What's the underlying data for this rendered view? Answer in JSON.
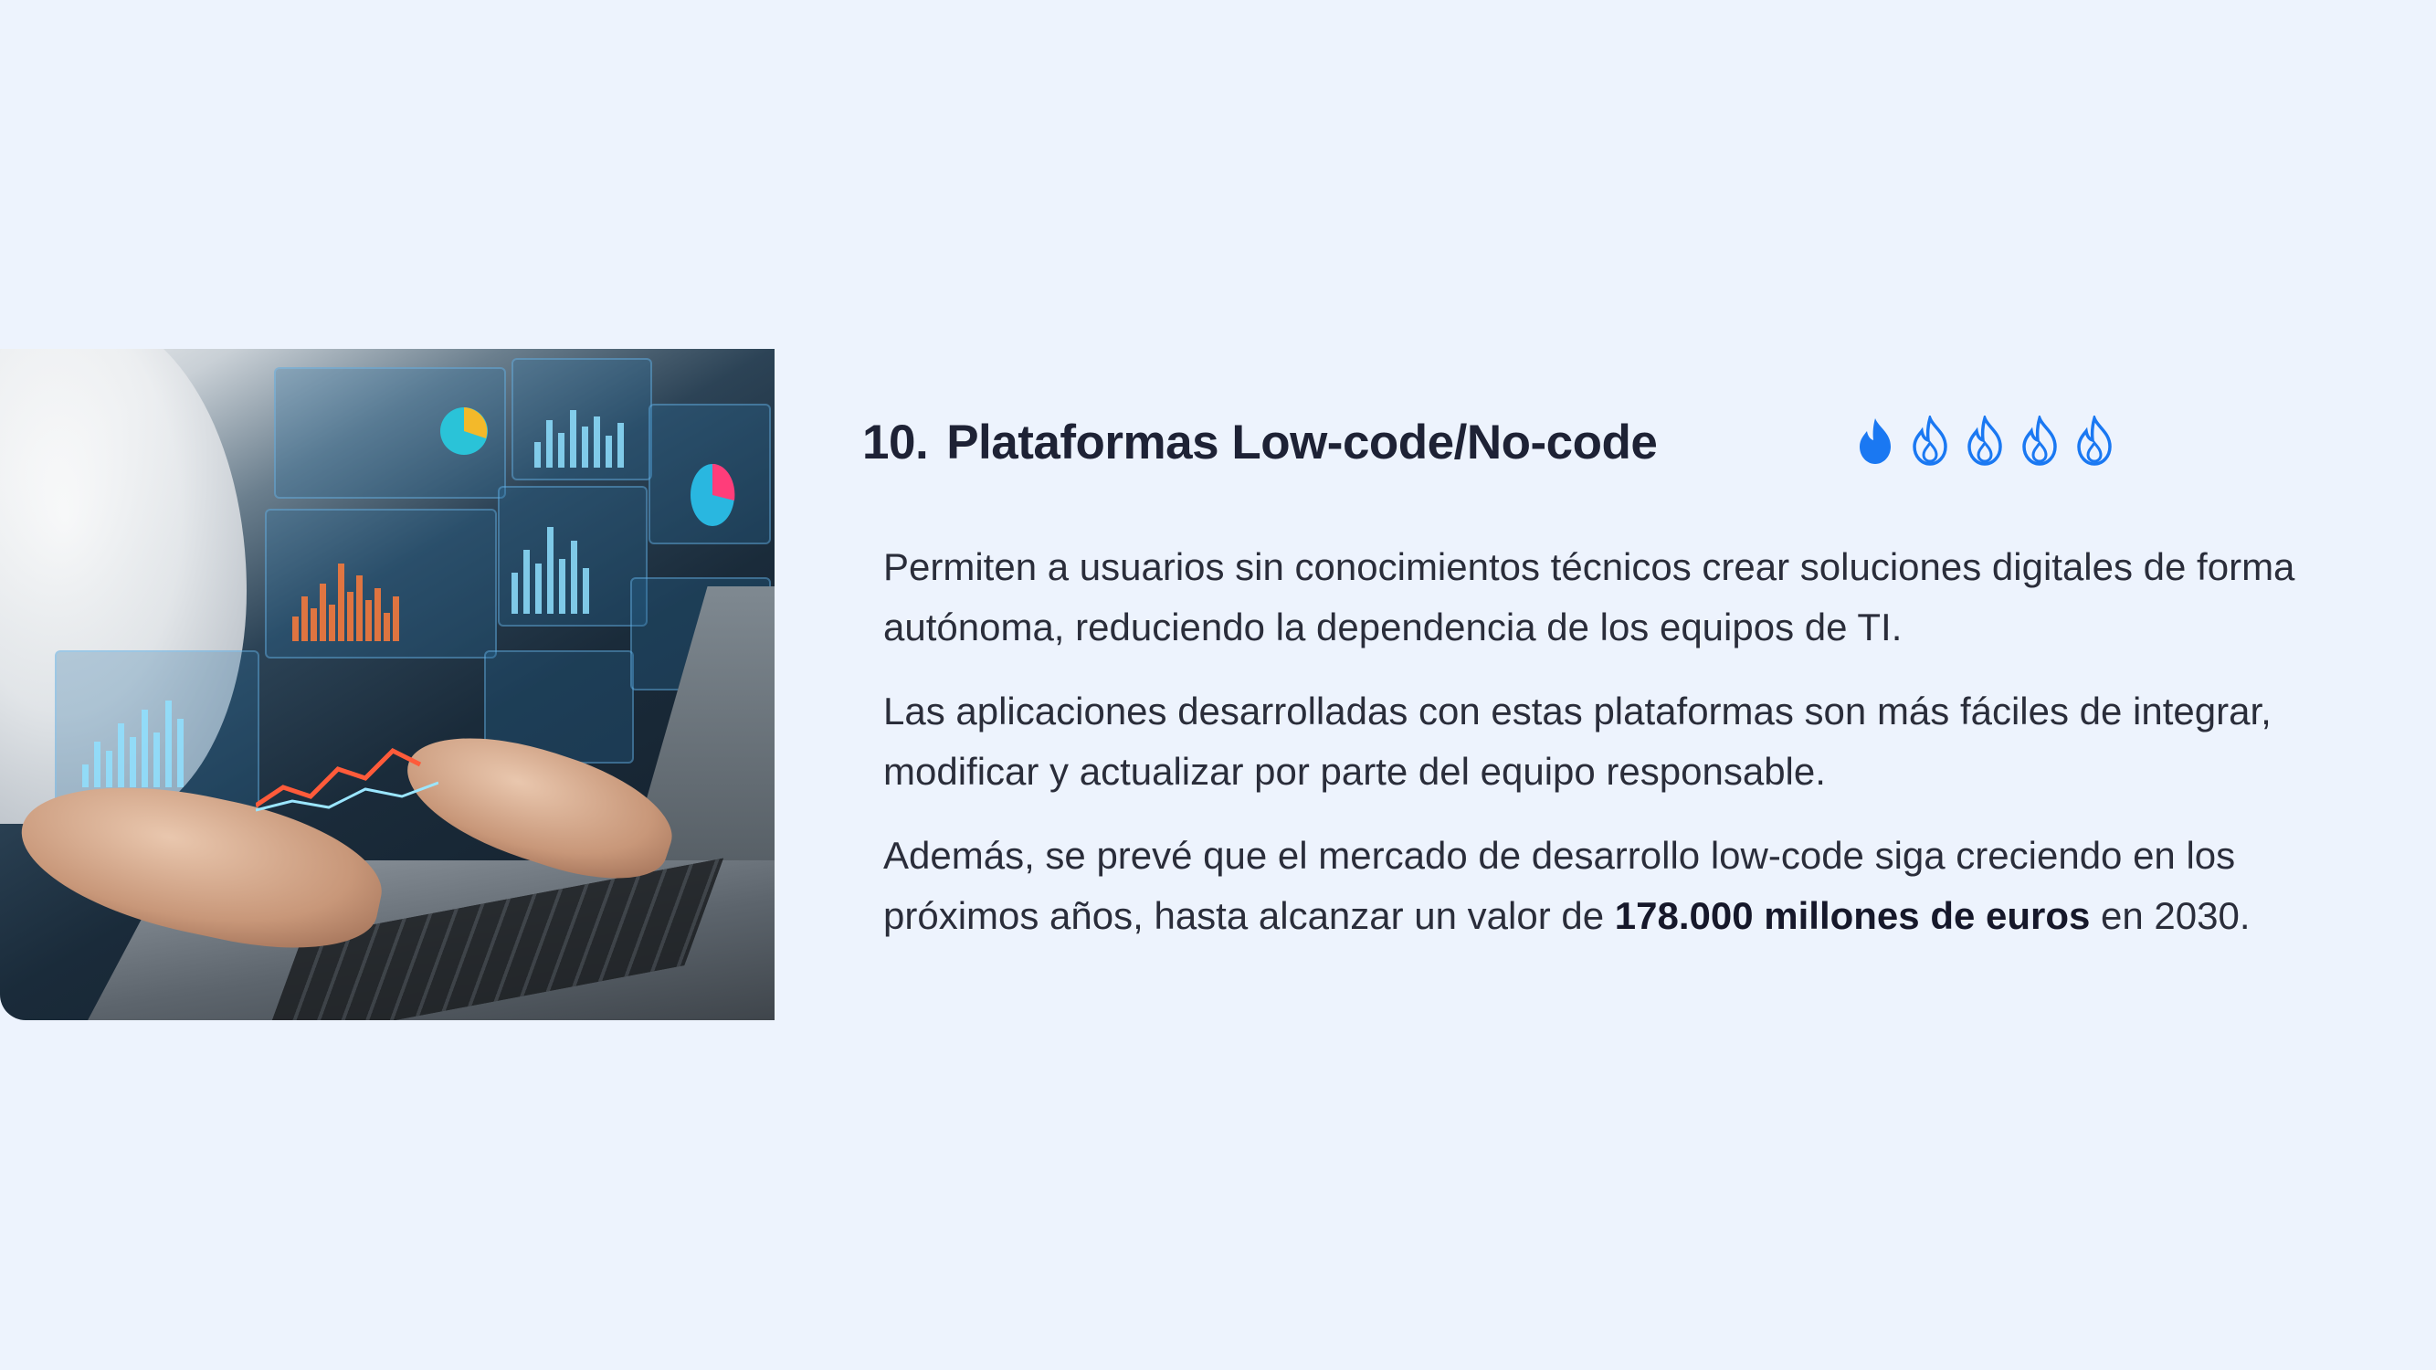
{
  "section": {
    "number": "10.",
    "title": "Plataformas Low-code/No-code",
    "rating": {
      "value": 1,
      "max": 5,
      "icon": "flame-icon",
      "color": "#1a78f2"
    }
  },
  "paragraphs": [
    {
      "text": "Permiten a usuarios sin conocimientos técnicos crear soluciones digitales de forma autónoma, reduciendo la dependencia de los equipos de TI."
    },
    {
      "text": "Las aplicaciones desarrolladas con estas plataformas son más fáciles de integrar, modificar y actualizar por parte del equipo responsable."
    },
    {
      "before": "Además, se prevé que el mercado de desarrollo low-code siga creciendo en los próximos años, hasta alcanzar un valor de ",
      "bold": "178.000 millones de euros",
      "after": " en 2030."
    }
  ],
  "image": {
    "subject": "person-using-laptop-with-holographic-dashboards"
  }
}
